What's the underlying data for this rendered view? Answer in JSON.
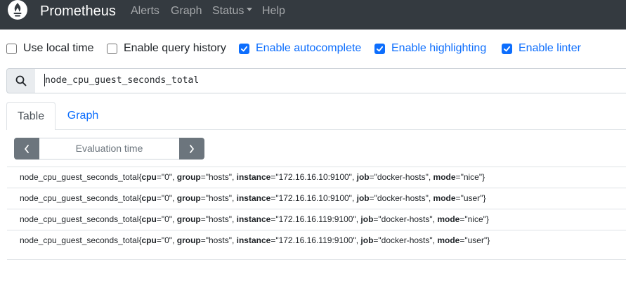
{
  "navbar": {
    "brand": "Prometheus",
    "items": [
      {
        "label": "Alerts"
      },
      {
        "label": "Graph"
      },
      {
        "label": "Status"
      },
      {
        "label": "Help"
      }
    ]
  },
  "options": [
    {
      "label": "Use local time",
      "checked": false
    },
    {
      "label": "Enable query history",
      "checked": false
    },
    {
      "label": "Enable autocomplete",
      "checked": true
    },
    {
      "label": "Enable highlighting",
      "checked": true
    },
    {
      "label": "Enable linter",
      "checked": true
    }
  ],
  "search": {
    "query": "node_cpu_guest_seconds_total"
  },
  "tabs": {
    "table": "Table",
    "graph": "Graph"
  },
  "eval": {
    "placeholder": "Evaluation time"
  },
  "results": [
    {
      "metric": "node_cpu_guest_seconds_total",
      "cpu": "\"0\"",
      "group": "\"hosts\"",
      "instance": "\"172.16.16.10:9100\"",
      "job": "\"docker-hosts\"",
      "mode": "\"nice\""
    },
    {
      "metric": "node_cpu_guest_seconds_total",
      "cpu": "\"0\"",
      "group": "\"hosts\"",
      "instance": "\"172.16.16.10:9100\"",
      "job": "\"docker-hosts\"",
      "mode": "\"user\""
    },
    {
      "metric": "node_cpu_guest_seconds_total",
      "cpu": "\"0\"",
      "group": "\"hosts\"",
      "instance": "\"172.16.16.119:9100\"",
      "job": "\"docker-hosts\"",
      "mode": "\"nice\""
    },
    {
      "metric": "node_cpu_guest_seconds_total",
      "cpu": "\"0\"",
      "group": "\"hosts\"",
      "instance": "\"172.16.16.119:9100\"",
      "job": "\"docker-hosts\"",
      "mode": "\"user\""
    }
  ],
  "labels": {
    "cpu": "cpu",
    "group": "group",
    "instance": "instance",
    "job": "job",
    "mode": "mode"
  },
  "colors": {
    "navbar": "#343a40",
    "accent": "#0d6efd",
    "secondary": "#6c757d"
  },
  "icons": {
    "logo": "prometheus-flame-icon",
    "search": "search-icon",
    "prev": "chevron-left-icon",
    "next": "chevron-right-icon",
    "check": "check-icon",
    "caret": "caret-down-icon"
  }
}
